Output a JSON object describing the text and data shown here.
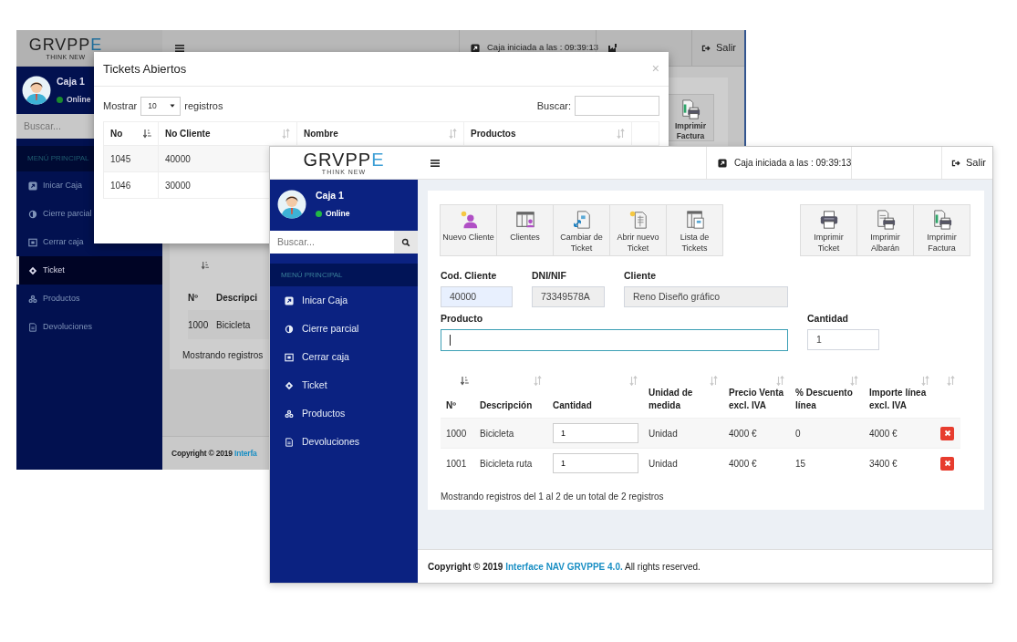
{
  "back_window": {
    "logo": {
      "wordmark": "GRVPPE",
      "tagline": "THINK NEW"
    },
    "session": "Caja iniciada a las : 09:39:13",
    "logout": "Salir",
    "user": {
      "name": "Caja 1",
      "status": "Online",
      "online": true
    },
    "search": {
      "placeholder": "Buscar..."
    },
    "menu_heading": "MENÚ PRINCIPAL",
    "menu": [
      {
        "kind": "start",
        "label": "Inicar Caja",
        "selected": false
      },
      {
        "kind": "partial",
        "label": "Cierre parcial",
        "selected": false
      },
      {
        "kind": "close",
        "label": "Cerrar caja",
        "selected": false
      },
      {
        "kind": "ticket",
        "label": "Ticket",
        "selected": true
      },
      {
        "kind": "products",
        "label": "Productos",
        "selected": false
      },
      {
        "kind": "returns",
        "label": "Devoluciones",
        "selected": false
      }
    ],
    "toolbar": [
      {
        "kind": "print-invoice",
        "label": "Imprimir Factura"
      }
    ],
    "table": {
      "columns": [
        {
          "label": "Nº",
          "kind": "sorted"
        },
        {
          "label": "Descripci",
          "kind": "hidden"
        }
      ],
      "rows": [
        [
          "1000",
          "Bicicleta"
        ]
      ]
    },
    "info": "Mostrando registros",
    "footer": {
      "text": "Copyright © 2019",
      "link": "Interfa"
    }
  },
  "modal": {
    "title": "Tickets Abiertos",
    "close": "×",
    "length_before": "Mostrar",
    "length_value": "10",
    "length_after": "registros",
    "search_label": "Buscar:",
    "columns": [
      {
        "label": "No",
        "kind": "sorted"
      },
      {
        "label": "No Cliente",
        "kind": "sortable"
      },
      {
        "label": "Nombre",
        "kind": "sortable"
      },
      {
        "label": "Productos",
        "kind": "sortable"
      },
      {
        "kind": "blank"
      }
    ],
    "rows": [
      [
        "1045",
        "40000"
      ],
      [
        "1046",
        "30000"
      ]
    ]
  },
  "front_window": {
    "logo": {
      "wordmark": "GRVPPE",
      "tagline": "THINK NEW"
    },
    "session": "Caja iniciada a las : 09:39:13",
    "logout": "Salir",
    "user": {
      "name": "Caja 1",
      "status": "Online",
      "online": true
    },
    "search": {
      "placeholder": "Buscar..."
    },
    "menu_heading": "MENÚ PRINCIPAL",
    "menu": [
      {
        "kind": "start",
        "label": "Inicar Caja",
        "selected": false
      },
      {
        "kind": "partial",
        "label": "Cierre parcial",
        "selected": false
      },
      {
        "kind": "close",
        "label": "Cerrar caja",
        "selected": false
      },
      {
        "kind": "ticket",
        "label": "Ticket",
        "selected": false
      },
      {
        "kind": "products",
        "label": "Productos",
        "selected": false
      },
      {
        "kind": "returns",
        "label": "Devoluciones",
        "selected": false
      }
    ],
    "toolbar_left": [
      {
        "kind": "new-client",
        "label": "Nuevo Cliente"
      },
      {
        "kind": "clients",
        "label": "Clientes"
      },
      {
        "kind": "change-ticket",
        "label": "Cambiar de Ticket"
      },
      {
        "kind": "new-ticket",
        "label": "Abrir nuevo Ticket"
      },
      {
        "kind": "ticket-list",
        "label": "Lista de Tickets"
      }
    ],
    "toolbar_right": [
      {
        "kind": "print",
        "label": "Imprimir Ticket"
      },
      {
        "kind": "print-delivery",
        "label": "Imprimir Albarán"
      },
      {
        "kind": "print-invoice",
        "label": "Imprimir Factura"
      }
    ],
    "fields": [
      {
        "label": "Cod. Cliente",
        "value": "40000",
        "readonly": false,
        "autofilled": true
      },
      {
        "label": "DNI/NIF",
        "value": "73349578A",
        "readonly": true,
        "autofilled": false
      },
      {
        "label": "Cliente",
        "value": "Reno Diseño gráfico",
        "readonly": true,
        "autofilled": false
      }
    ],
    "product": {
      "label": "Producto",
      "focused": true
    },
    "quantity": {
      "label": "Cantidad",
      "value": "1"
    },
    "table": {
      "columns": [
        {
          "label": "Nº",
          "kind": "sorted"
        },
        {
          "label": "Descripción",
          "kind": "sortable"
        },
        {
          "label": "Cantidad",
          "kind": "sortable"
        },
        {
          "label": "Unidad de medida",
          "kind": "sortable"
        },
        {
          "label": "Precio Venta excl. IVA",
          "kind": "sortable"
        },
        {
          "label": "% Descuento línea",
          "kind": "sortable"
        },
        {
          "label": "Importe línea excl. IVA",
          "kind": "sortable"
        },
        {
          "kind": "sortable"
        }
      ],
      "rows": [
        {
          "no": "1000",
          "description": "Bicicleta",
          "quantity": "1",
          "unit": "Unidad",
          "price": "4000 €",
          "discount": "0",
          "amount": "4000 €"
        },
        {
          "no": "1001",
          "description": "Bicicleta ruta",
          "quantity": "1",
          "unit": "Unidad",
          "price": "4000 €",
          "discount": "15",
          "amount": "3400 €"
        }
      ]
    },
    "info": "Mostrando registros del 1 al 2 de un total de 2 registros",
    "footer": {
      "text": "Copyright © 2019",
      "link": "Interface NAV GRVPPE 4.0.",
      "after": "All rights reserved."
    }
  }
}
